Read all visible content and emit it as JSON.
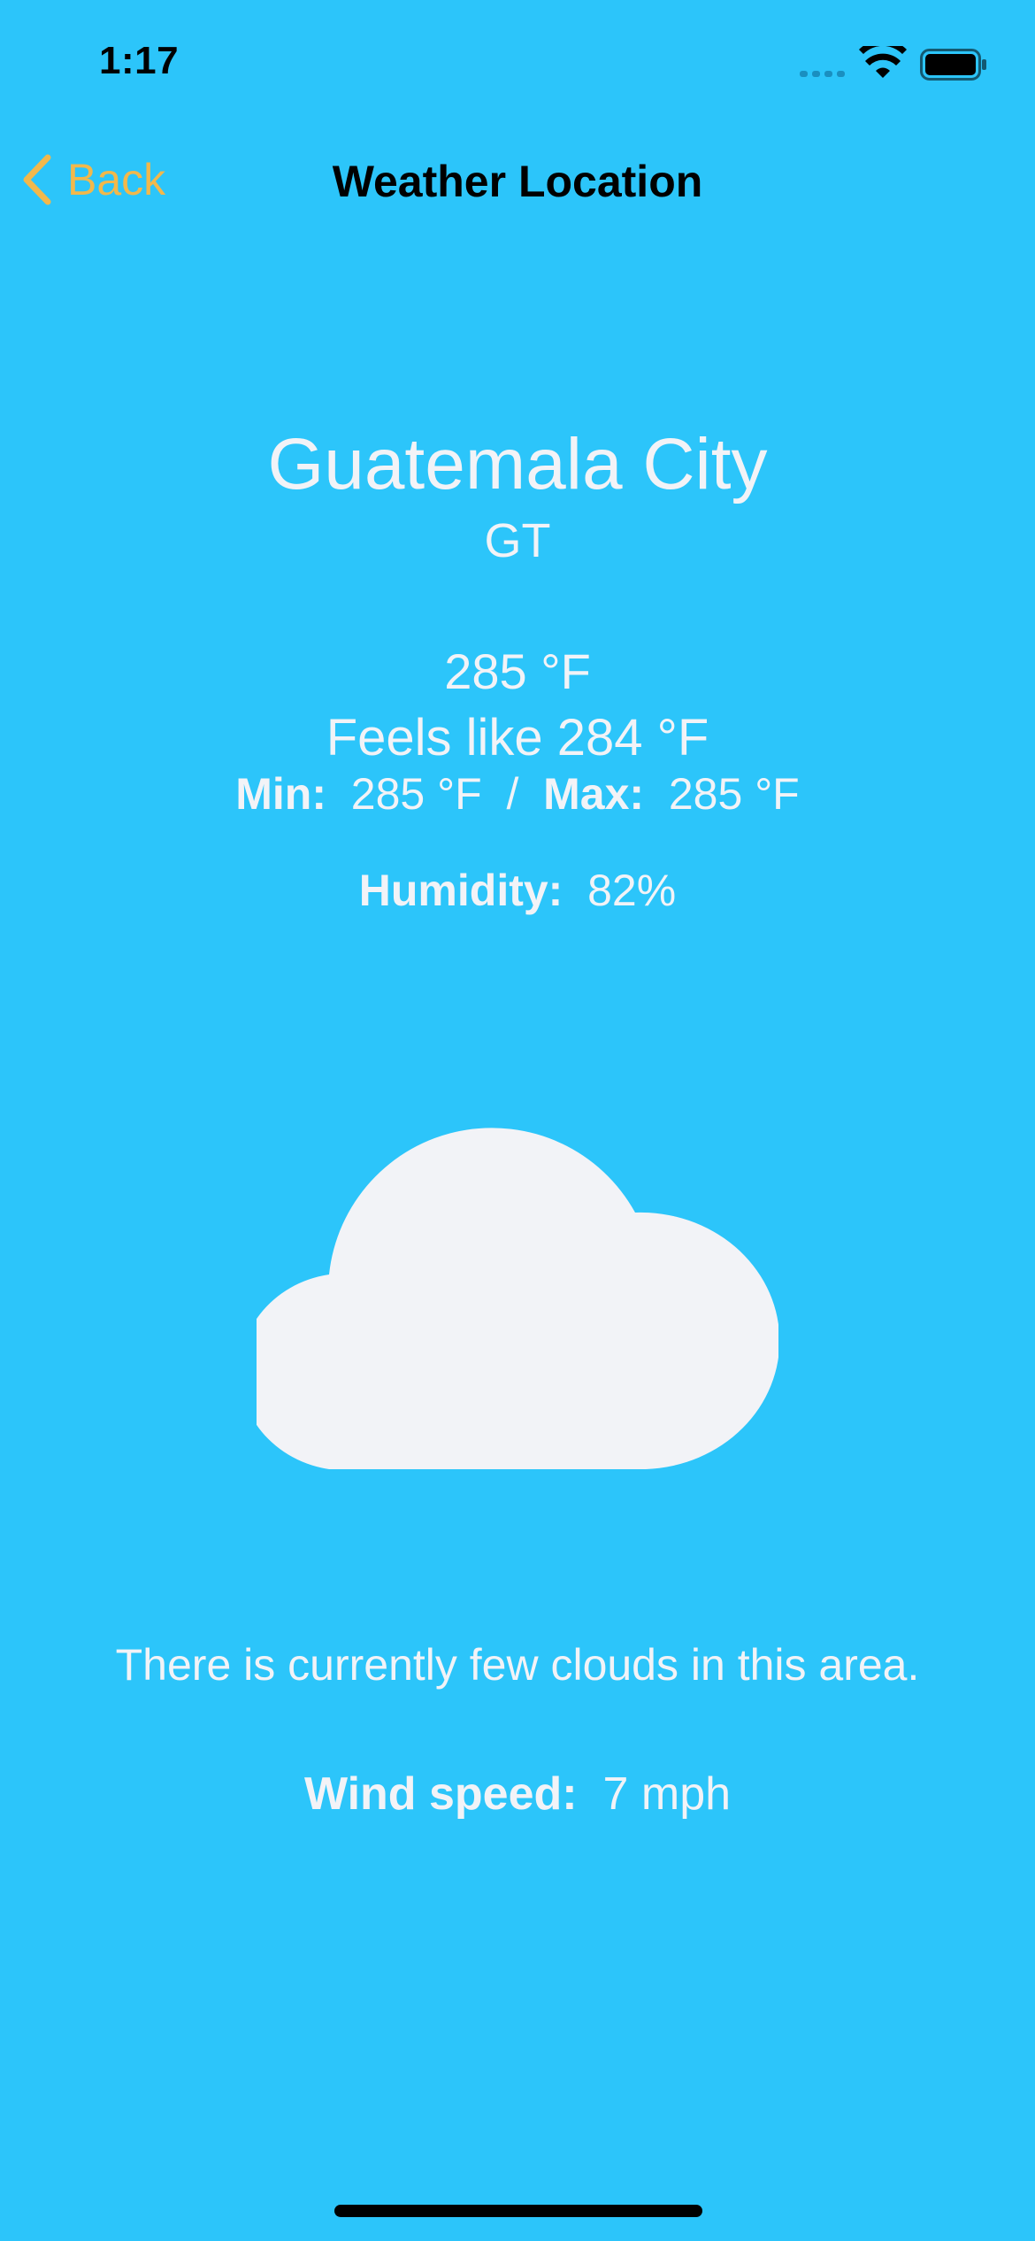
{
  "status_bar": {
    "time": "1:17",
    "signal_icon": "cellular-dots-icon",
    "wifi_icon": "wifi-icon",
    "battery_icon": "battery-icon"
  },
  "nav": {
    "back_label": "Back",
    "title": "Weather Location",
    "accent_color": "#F2B84B"
  },
  "weather": {
    "city": "Guatemala City",
    "country": "GT",
    "temperature": "285 °F",
    "feels_like": "Feels like 284 °F",
    "min_label": "Min:",
    "min_value": "285 °F",
    "separator": "/",
    "max_label": "Max:",
    "max_value": "285 °F",
    "humidity_label": "Humidity:",
    "humidity_value": "82%",
    "condition_icon": "cloud-icon",
    "description": "There is currently few clouds in this area.",
    "wind_label": "Wind speed:",
    "wind_value": "7 mph"
  },
  "colors": {
    "background": "#2CC5FA",
    "text": "#F2F3F7"
  }
}
